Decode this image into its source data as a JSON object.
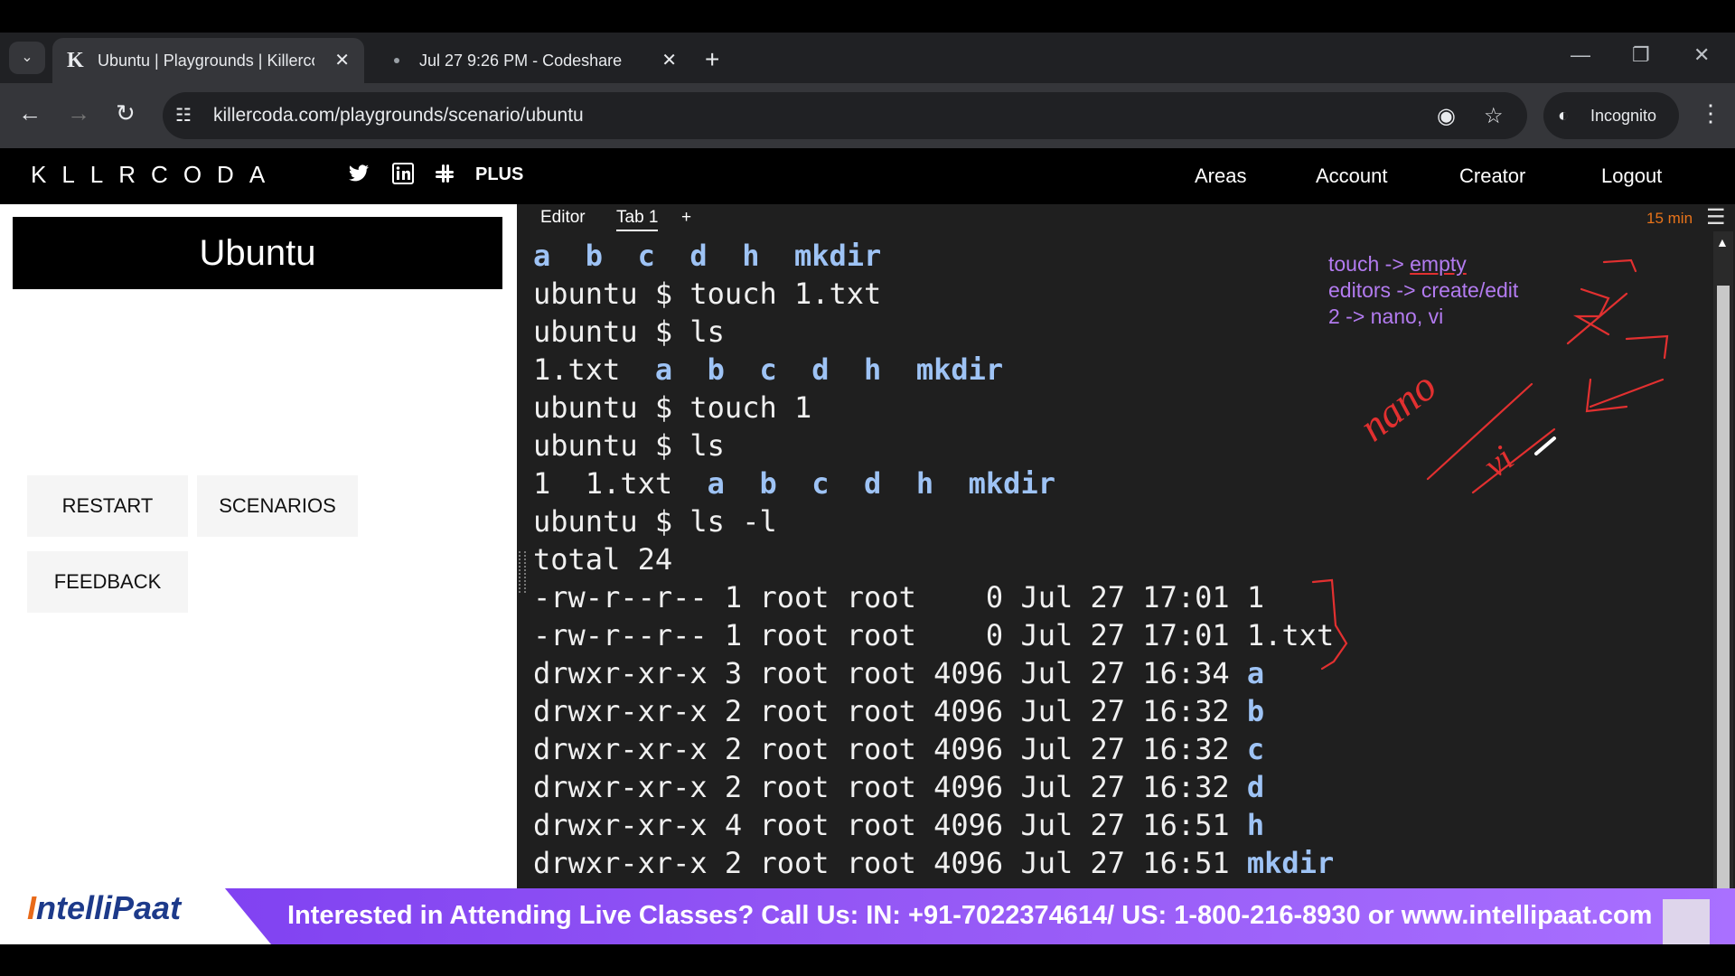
{
  "browser": {
    "tabs": [
      {
        "favicon": "K",
        "title": "Ubuntu | Playgrounds | Killerco",
        "active": true
      },
      {
        "favicon": "",
        "title": "Jul 27 9:26 PM - Codeshare",
        "active": false
      }
    ],
    "url": "killercoda.com/playgrounds/scenario/ubuntu",
    "incognito_label": "Incognito"
  },
  "app": {
    "logo": "KLLRCODA",
    "plus_label": "PLUS",
    "nav": [
      "Areas",
      "Account",
      "Creator",
      "Logout"
    ]
  },
  "left_panel": {
    "title": "Ubuntu",
    "buttons": {
      "restart": "RESTART",
      "scenarios": "SCENARIOS",
      "feedback": "FEEDBACK"
    }
  },
  "terminal": {
    "tabs": {
      "editor": "Editor",
      "tab1": "Tab 1",
      "add": "+"
    },
    "timer": "15 min",
    "lines": [
      {
        "text": "",
        "dirs": "a  b  c  d  h  mkdir"
      },
      {
        "text": "ubuntu $ touch 1.txt",
        "dirs": ""
      },
      {
        "text": "ubuntu $ ls",
        "dirs": ""
      },
      {
        "text": "1.txt  ",
        "dirs": "a  b  c  d  h  mkdir"
      },
      {
        "text": "ubuntu $ touch 1",
        "dirs": ""
      },
      {
        "text": "ubuntu $ ls",
        "dirs": ""
      },
      {
        "text": "1  1.txt  ",
        "dirs": "a  b  c  d  h  mkdir"
      },
      {
        "text": "ubuntu $ ls -l",
        "dirs": ""
      },
      {
        "text": "total 24",
        "dirs": ""
      },
      {
        "text": "-rw-r--r-- 1 root root    0 Jul 27 17:01 1",
        "dirs": ""
      },
      {
        "text": "-rw-r--r-- 1 root root    0 Jul 27 17:01 1.txt",
        "dirs": ""
      },
      {
        "text": "drwxr-xr-x 3 root root 4096 Jul 27 16:34 ",
        "dirs": "a"
      },
      {
        "text": "drwxr-xr-x 2 root root 4096 Jul 27 16:32 ",
        "dirs": "b"
      },
      {
        "text": "drwxr-xr-x 2 root root 4096 Jul 27 16:32 ",
        "dirs": "c"
      },
      {
        "text": "drwxr-xr-x 2 root root 4096 Jul 27 16:32 ",
        "dirs": "d"
      },
      {
        "text": "drwxr-xr-x 4 root root 4096 Jul 27 16:51 ",
        "dirs": "h"
      },
      {
        "text": "drwxr-xr-x 2 root root 4096 Jul 27 16:51 ",
        "dirs": "mkdir"
      }
    ]
  },
  "notes": {
    "line1_prefix": "touch -> ",
    "line1_underlined": "empty",
    "line2": "editors -> create/edit",
    "line3": "2 -> nano, vi",
    "handwriting": [
      "nano",
      "vi"
    ]
  },
  "banner": {
    "brand_i": "I",
    "brand_rest": "ntelliPaat",
    "text": "Interested in Attending Live Classes? Call Us: IN: +91-7022374614/ US: 1-800-216-8930 or www.intellipaat.com"
  },
  "colors": {
    "accent_purple": "#9457f5",
    "dir_blue": "#9ec3f5",
    "timer_orange": "#e8731a",
    "note_purple": "#b37bf0",
    "ink_red": "#e23030"
  }
}
